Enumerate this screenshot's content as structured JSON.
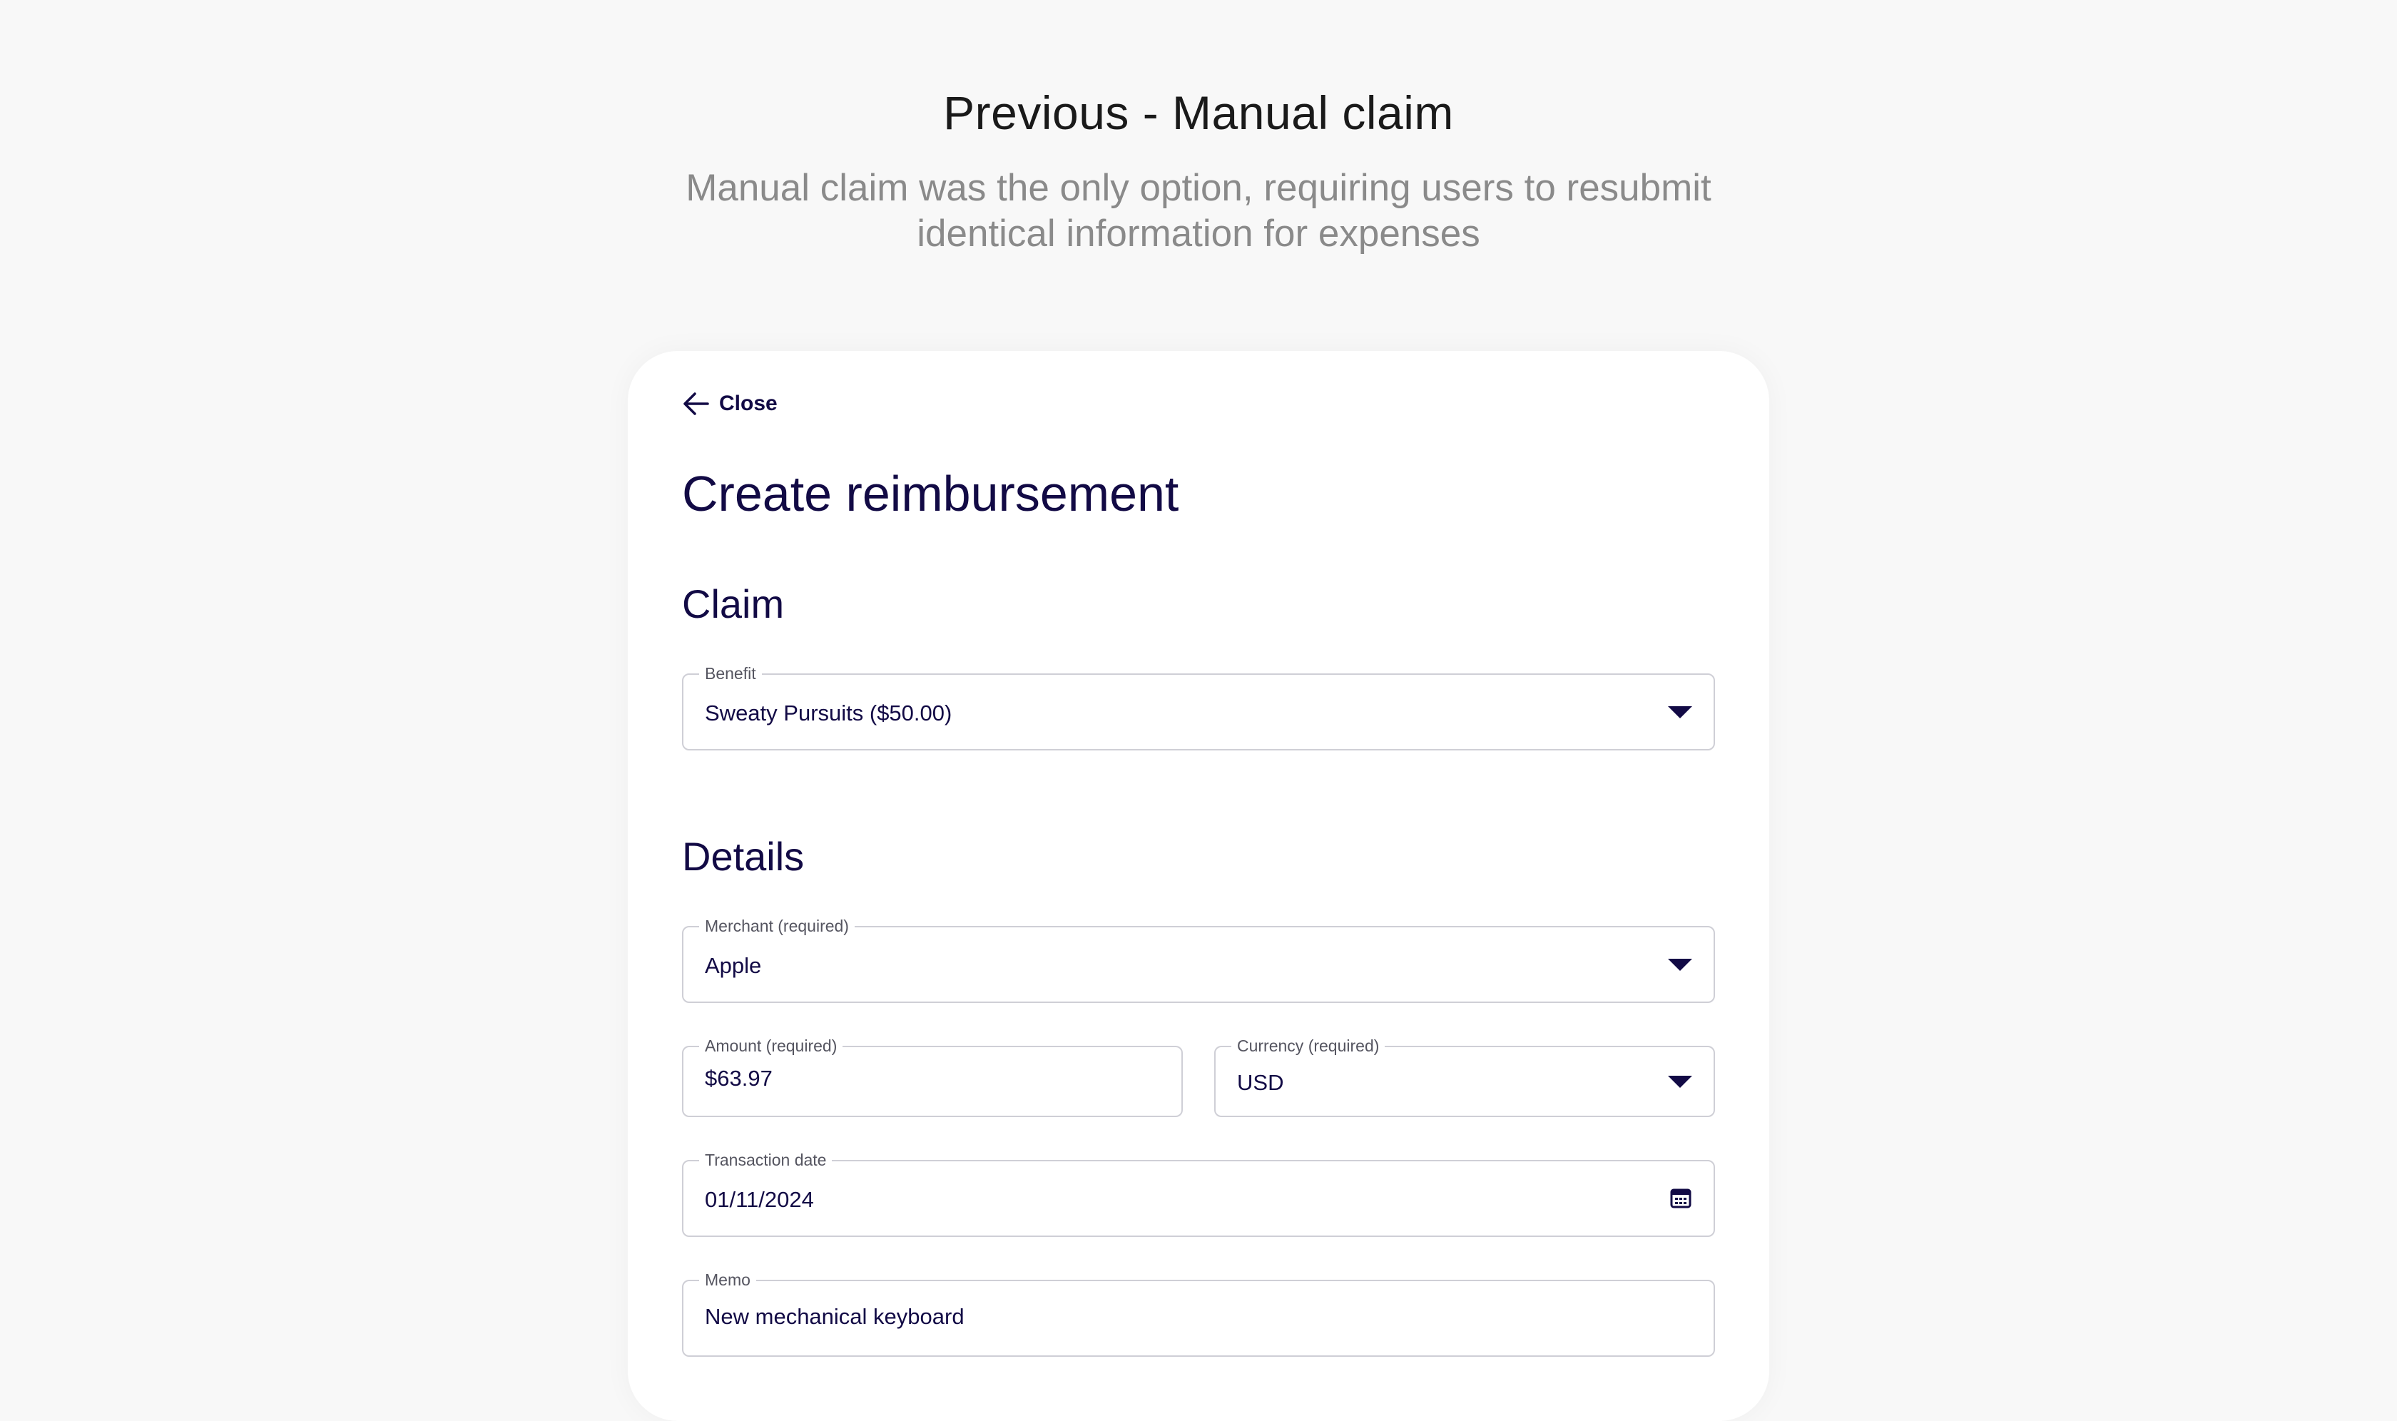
{
  "header": {
    "title": "Previous - Manual claim",
    "subtitle": "Manual claim was the only option, requiring users to resubmit identical information for expenses"
  },
  "card": {
    "close_label": "Close",
    "title": "Create reimbursement",
    "sections": {
      "claim": "Claim",
      "details": "Details"
    },
    "fields": {
      "benefit": {
        "label": "Benefit",
        "value": "Sweaty Pursuits ($50.00)"
      },
      "merchant": {
        "label": "Merchant (required)",
        "value": "Apple"
      },
      "amount": {
        "label": "Amount (required)",
        "value": "$63.97"
      },
      "currency": {
        "label": "Currency (required)",
        "value": "USD"
      },
      "transaction_date": {
        "label": "Transaction date",
        "value": "01/11/2024"
      },
      "memo": {
        "label": "Memo",
        "value": "New mechanical keyboard"
      }
    }
  },
  "colors": {
    "ink": "#120a45",
    "background": "#f8f8f8",
    "border": "#cfcfd6"
  },
  "icons": {
    "close": "arrow-left-icon",
    "dropdown": "caret-down-icon",
    "date": "calendar-icon"
  }
}
